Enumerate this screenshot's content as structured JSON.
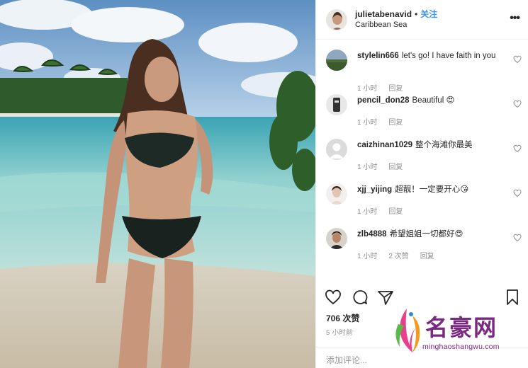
{
  "post": {
    "username": "julietabenavid",
    "separator": "•",
    "follow_label": "关注",
    "location": "Caribbean Sea",
    "more_icon": "•••"
  },
  "comments": [
    {
      "user": "stylelin666",
      "text": "let's go! I have faith in you",
      "time": "1 小时",
      "likes": "",
      "reply": "回复"
    },
    {
      "user": "pencil_don28",
      "text": "Beautiful 😍",
      "time": "1 小时",
      "likes": "",
      "reply": "回复"
    },
    {
      "user": "caizhinan1029",
      "text": "整个海滩你最美",
      "time": "1 小时",
      "likes": "",
      "reply": "回复"
    },
    {
      "user": "xjj_yijing",
      "text": "超靓！一定要开心😘",
      "time": "1 小时",
      "likes": "",
      "reply": "回复"
    },
    {
      "user": "zlb4888",
      "text": "希望姐姐一切都好😍",
      "time": "1 小时",
      "likes": "2 次赞",
      "reply": "回复"
    }
  ],
  "footer": {
    "likes": "706 次赞",
    "time": "5 小时前",
    "add_comment_placeholder": "添加评论..."
  },
  "watermark": {
    "title": "名豪网",
    "subtitle": "minghaoshangwu.com"
  },
  "colors": {
    "follow": "#3897f0",
    "watermark": "#7a2a80",
    "meta": "#8e8e8e"
  }
}
